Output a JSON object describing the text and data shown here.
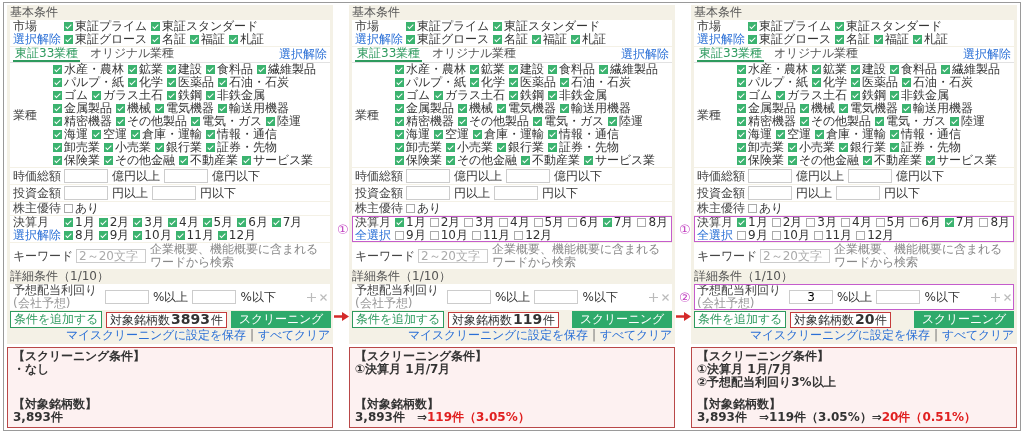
{
  "panels": [
    {
      "section_title": "基本条件",
      "market": {
        "label": "市場",
        "link": "選択解除",
        "options": [
          {
            "label": "東証プライム",
            "checked": true
          },
          {
            "label": "東証スタンダード",
            "checked": true
          },
          {
            "label": "東証グロース",
            "checked": true
          },
          {
            "label": "名証",
            "checked": true
          },
          {
            "label": "福証",
            "checked": true
          },
          {
            "label": "札証",
            "checked": true
          }
        ]
      },
      "tabs": [
        {
          "label": "東証33業種",
          "selected": true
        },
        {
          "label": "オリジナル業種",
          "selected": false
        }
      ],
      "industry": {
        "label": "業種",
        "link": "選択解除",
        "options": [
          {
            "label": "水産・農林",
            "checked": true
          },
          {
            "label": "鉱業",
            "checked": true
          },
          {
            "label": "建設",
            "checked": true
          },
          {
            "label": "食料品",
            "checked": true
          },
          {
            "label": "繊維製品",
            "checked": true
          },
          {
            "label": "パルプ・紙",
            "checked": true
          },
          {
            "label": "化学",
            "checked": true
          },
          {
            "label": "医薬品",
            "checked": true
          },
          {
            "label": "石油・石炭",
            "checked": true
          },
          {
            "label": "ゴム",
            "checked": true
          },
          {
            "label": "ガラス土石",
            "checked": true
          },
          {
            "label": "鉄鋼",
            "checked": true
          },
          {
            "label": "非鉄金属",
            "checked": true
          },
          {
            "label": "金属製品",
            "checked": true
          },
          {
            "label": "機械",
            "checked": true
          },
          {
            "label": "電気機器",
            "checked": true
          },
          {
            "label": "輸送用機器",
            "checked": true
          },
          {
            "label": "精密機器",
            "checked": true
          },
          {
            "label": "その他製品",
            "checked": true
          },
          {
            "label": "電気・ガス",
            "checked": true
          },
          {
            "label": "陸運",
            "checked": true
          },
          {
            "label": "海運",
            "checked": true
          },
          {
            "label": "空運",
            "checked": true
          },
          {
            "label": "倉庫・運輸",
            "checked": true
          },
          {
            "label": "情報・通信",
            "checked": true
          },
          {
            "label": "卸売業",
            "checked": true
          },
          {
            "label": "小売業",
            "checked": true
          },
          {
            "label": "銀行業",
            "checked": true
          },
          {
            "label": "証券・先物",
            "checked": true
          },
          {
            "label": "保険業",
            "checked": true
          },
          {
            "label": "その他金融",
            "checked": true
          },
          {
            "label": "不動産業",
            "checked": true
          },
          {
            "label": "サービス業",
            "checked": true
          }
        ]
      },
      "market_cap": {
        "label": "時価総額",
        "unit_min": "億円以上",
        "unit_max": "億円以下"
      },
      "investment": {
        "label": "投資金額",
        "unit_min": "円以上",
        "unit_max": "円以下"
      },
      "benefits": {
        "label": "株主優待",
        "option": {
          "label": "あり",
          "checked": false
        }
      },
      "settlement": {
        "label": "決算月",
        "link": "選択解除",
        "highlighted": false,
        "months": [
          {
            "label": "1月",
            "checked": true
          },
          {
            "label": "2月",
            "checked": true
          },
          {
            "label": "3月",
            "checked": true
          },
          {
            "label": "4月",
            "checked": true
          },
          {
            "label": "5月",
            "checked": true
          },
          {
            "label": "6月",
            "checked": true
          },
          {
            "label": "7月",
            "checked": true
          },
          {
            "label": "8月",
            "checked": true
          },
          {
            "label": "9月",
            "checked": true
          },
          {
            "label": "10月",
            "checked": true
          },
          {
            "label": "11月",
            "checked": true
          },
          {
            "label": "12月",
            "checked": true
          }
        ]
      },
      "keyword": {
        "label": "キーワード",
        "placeholder": "2～20文字",
        "hint": "企業概要、機能概要に含まれるワードから検索"
      },
      "detail_title": "詳細条件（1/10）",
      "dividend": {
        "label": "予想配当利回り",
        "sublabel": "(会社予想)",
        "unit_min": "%以上",
        "unit_max": "%以下",
        "highlighted": false
      },
      "add_button": "条件を追加する",
      "count": {
        "label": "対象銘柄数",
        "value": "3893",
        "unit": "件"
      },
      "screen_button": "スクリーニング",
      "save_link": "マイスクリーニングに設定を保存",
      "separator": "|",
      "clear_link": "すべてクリア"
    },
    {
      "section_title": "基本条件",
      "market": {
        "label": "市場",
        "link": "選択解除",
        "options": [
          {
            "label": "東証プライム",
            "checked": true
          },
          {
            "label": "東証スタンダード",
            "checked": true
          },
          {
            "label": "東証グロース",
            "checked": true
          },
          {
            "label": "名証",
            "checked": true
          },
          {
            "label": "福証",
            "checked": true
          },
          {
            "label": "札証",
            "checked": true
          }
        ]
      },
      "tabs": [
        {
          "label": "東証33業種",
          "selected": true
        },
        {
          "label": "オリジナル業種",
          "selected": false
        }
      ],
      "industry": {
        "label": "業種",
        "link": "選択解除",
        "options": [
          {
            "label": "水産・農林",
            "checked": true
          },
          {
            "label": "鉱業",
            "checked": true
          },
          {
            "label": "建設",
            "checked": true
          },
          {
            "label": "食料品",
            "checked": true
          },
          {
            "label": "繊維製品",
            "checked": true
          },
          {
            "label": "パルプ・紙",
            "checked": true
          },
          {
            "label": "化学",
            "checked": true
          },
          {
            "label": "医薬品",
            "checked": true
          },
          {
            "label": "石油・石炭",
            "checked": true
          },
          {
            "label": "ゴム",
            "checked": true
          },
          {
            "label": "ガラス土石",
            "checked": true
          },
          {
            "label": "鉄鋼",
            "checked": true
          },
          {
            "label": "非鉄金属",
            "checked": true
          },
          {
            "label": "金属製品",
            "checked": true
          },
          {
            "label": "機械",
            "checked": true
          },
          {
            "label": "電気機器",
            "checked": true
          },
          {
            "label": "輸送用機器",
            "checked": true
          },
          {
            "label": "精密機器",
            "checked": true
          },
          {
            "label": "その他製品",
            "checked": true
          },
          {
            "label": "電気・ガス",
            "checked": true
          },
          {
            "label": "陸運",
            "checked": true
          },
          {
            "label": "海運",
            "checked": true
          },
          {
            "label": "空運",
            "checked": true
          },
          {
            "label": "倉庫・運輸",
            "checked": true
          },
          {
            "label": "情報・通信",
            "checked": true
          },
          {
            "label": "卸売業",
            "checked": true
          },
          {
            "label": "小売業",
            "checked": true
          },
          {
            "label": "銀行業",
            "checked": true
          },
          {
            "label": "証券・先物",
            "checked": true
          },
          {
            "label": "保険業",
            "checked": true
          },
          {
            "label": "その他金融",
            "checked": true
          },
          {
            "label": "不動産業",
            "checked": true
          },
          {
            "label": "サービス業",
            "checked": true
          }
        ]
      },
      "market_cap": {
        "label": "時価総額",
        "unit_min": "億円以上",
        "unit_max": "億円以下"
      },
      "investment": {
        "label": "投資金額",
        "unit_min": "円以上",
        "unit_max": "円以下"
      },
      "benefits": {
        "label": "株主優待",
        "option": {
          "label": "あり",
          "checked": false
        }
      },
      "settlement": {
        "label": "決算月",
        "link": "全選択",
        "highlighted": true,
        "marker": "①",
        "months": [
          {
            "label": "1月",
            "checked": true
          },
          {
            "label": "2月",
            "checked": false
          },
          {
            "label": "3月",
            "checked": false
          },
          {
            "label": "4月",
            "checked": false
          },
          {
            "label": "5月",
            "checked": false
          },
          {
            "label": "6月",
            "checked": false
          },
          {
            "label": "7月",
            "checked": true
          },
          {
            "label": "8月",
            "checked": false
          },
          {
            "label": "9月",
            "checked": false
          },
          {
            "label": "10月",
            "checked": false
          },
          {
            "label": "11月",
            "checked": false
          },
          {
            "label": "12月",
            "checked": false
          }
        ]
      },
      "keyword": {
        "label": "キーワード",
        "placeholder": "2～20文字",
        "hint": "企業概要、機能概要に含まれるワードから検索"
      },
      "detail_title": "詳細条件（1/10）",
      "dividend": {
        "label": "予想配当利回り",
        "sublabel": "(会社予想)",
        "unit_min": "%以上",
        "unit_max": "%以下",
        "highlighted": false
      },
      "add_button": "条件を追加する",
      "count": {
        "label": "対象銘柄数",
        "value": "119",
        "unit": "件"
      },
      "screen_button": "スクリーニング",
      "save_link": "マイスクリーニングに設定を保存",
      "separator": "|",
      "clear_link": "すべてクリア"
    },
    {
      "section_title": "基本条件",
      "market": {
        "label": "市場",
        "link": "選択解除",
        "options": [
          {
            "label": "東証プライム",
            "checked": true
          },
          {
            "label": "東証スタンダード",
            "checked": true
          },
          {
            "label": "東証グロース",
            "checked": true
          },
          {
            "label": "名証",
            "checked": true
          },
          {
            "label": "福証",
            "checked": true
          },
          {
            "label": "札証",
            "checked": true
          }
        ]
      },
      "tabs": [
        {
          "label": "東証33業種",
          "selected": true
        },
        {
          "label": "オリジナル業種",
          "selected": false
        }
      ],
      "industry": {
        "label": "業種",
        "link": "選択解除",
        "options": [
          {
            "label": "水産・農林",
            "checked": true
          },
          {
            "label": "鉱業",
            "checked": true
          },
          {
            "label": "建設",
            "checked": true
          },
          {
            "label": "食料品",
            "checked": true
          },
          {
            "label": "繊維製品",
            "checked": true
          },
          {
            "label": "パルプ・紙",
            "checked": true
          },
          {
            "label": "化学",
            "checked": true
          },
          {
            "label": "医薬品",
            "checked": true
          },
          {
            "label": "石油・石炭",
            "checked": true
          },
          {
            "label": "ゴム",
            "checked": true
          },
          {
            "label": "ガラス土石",
            "checked": true
          },
          {
            "label": "鉄鋼",
            "checked": true
          },
          {
            "label": "非鉄金属",
            "checked": true
          },
          {
            "label": "金属製品",
            "checked": true
          },
          {
            "label": "機械",
            "checked": true
          },
          {
            "label": "電気機器",
            "checked": true
          },
          {
            "label": "輸送用機器",
            "checked": true
          },
          {
            "label": "精密機器",
            "checked": true
          },
          {
            "label": "その他製品",
            "checked": true
          },
          {
            "label": "電気・ガス",
            "checked": true
          },
          {
            "label": "陸運",
            "checked": true
          },
          {
            "label": "海運",
            "checked": true
          },
          {
            "label": "空運",
            "checked": true
          },
          {
            "label": "倉庫・運輸",
            "checked": true
          },
          {
            "label": "情報・通信",
            "checked": true
          },
          {
            "label": "卸売業",
            "checked": true
          },
          {
            "label": "小売業",
            "checked": true
          },
          {
            "label": "銀行業",
            "checked": true
          },
          {
            "label": "証券・先物",
            "checked": true
          },
          {
            "label": "保険業",
            "checked": true
          },
          {
            "label": "その他金融",
            "checked": true
          },
          {
            "label": "不動産業",
            "checked": true
          },
          {
            "label": "サービス業",
            "checked": true
          }
        ]
      },
      "market_cap": {
        "label": "時価総額",
        "unit_min": "億円以上",
        "unit_max": "億円以下"
      },
      "investment": {
        "label": "投資金額",
        "unit_min": "円以上",
        "unit_max": "円以下"
      },
      "benefits": {
        "label": "株主優待",
        "option": {
          "label": "あり",
          "checked": false
        }
      },
      "settlement": {
        "label": "決算月",
        "link": "全選択",
        "highlighted": true,
        "marker": "①",
        "months": [
          {
            "label": "1月",
            "checked": true
          },
          {
            "label": "2月",
            "checked": false
          },
          {
            "label": "3月",
            "checked": false
          },
          {
            "label": "4月",
            "checked": false
          },
          {
            "label": "5月",
            "checked": false
          },
          {
            "label": "6月",
            "checked": false
          },
          {
            "label": "7月",
            "checked": true
          },
          {
            "label": "8月",
            "checked": false
          },
          {
            "label": "9月",
            "checked": false
          },
          {
            "label": "10月",
            "checked": false
          },
          {
            "label": "11月",
            "checked": false
          },
          {
            "label": "12月",
            "checked": false
          }
        ]
      },
      "keyword": {
        "label": "キーワード",
        "placeholder": "2～20文字",
        "hint": "企業概要、機能概要に含まれるワードから検索"
      },
      "detail_title": "詳細条件（1/10）",
      "dividend": {
        "label": "予想配当利回り",
        "sublabel": "(会社予想)",
        "min": "3",
        "unit_min": "%以上",
        "unit_max": "%以下",
        "highlighted": true,
        "marker": "②"
      },
      "add_button": "条件を追加する",
      "count": {
        "label": "対象銘柄数",
        "value": "20",
        "unit": "件"
      },
      "screen_button": "スクリーニング",
      "save_link": "マイスクリーニングに設定を保存",
      "separator": "|",
      "clear_link": "すべてクリア"
    }
  ],
  "notes": [
    {
      "sections": [
        {
          "heading": "【スクリーニング条件】",
          "lines": [
            [
              {
                "text": "・なし",
                "highlight": false
              }
            ]
          ]
        },
        {
          "heading": "【対象銘柄数】",
          "lines": [
            [
              {
                "text": "3,893件",
                "highlight": false
              }
            ]
          ]
        }
      ]
    },
    {
      "sections": [
        {
          "heading": "【スクリーニング条件】",
          "lines": [
            [
              {
                "text": "①決算月 1月/7月",
                "highlight": false
              }
            ]
          ]
        },
        {
          "heading": "【対象銘柄数】",
          "lines": [
            [
              {
                "text": "3,893件　⇒",
                "highlight": false
              },
              {
                "text": "119件（3.05%）",
                "highlight": true
              }
            ]
          ]
        }
      ]
    },
    {
      "sections": [
        {
          "heading": "【スクリーニング条件】",
          "lines": [
            [
              {
                "text": "①決算月 1月/7月",
                "highlight": false
              }
            ],
            [
              {
                "text": "②予想配当利回り3%以上",
                "highlight": false
              }
            ]
          ]
        },
        {
          "heading": "【対象銘柄数】",
          "lines": [
            [
              {
                "text": "3,893件　⇒119件（3.05%）⇒",
                "highlight": false
              },
              {
                "text": "20件（0.51%）",
                "highlight": true
              }
            ]
          ]
        }
      ]
    }
  ]
}
